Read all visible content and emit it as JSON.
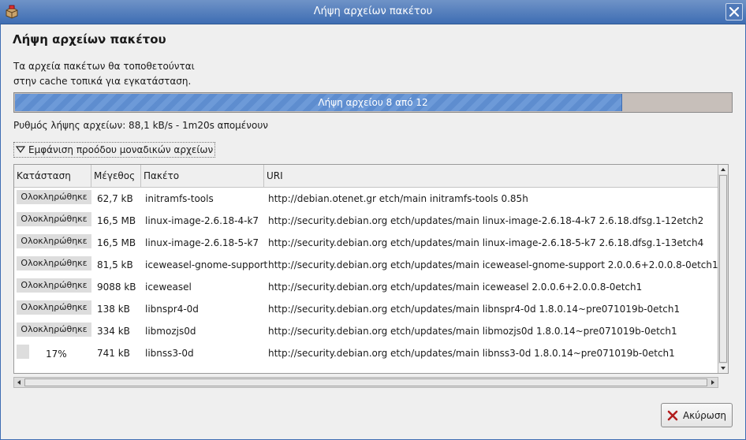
{
  "window": {
    "title": "Λήψη αρχείων πακέτου",
    "app_icon": "package-manager-icon",
    "close_icon": "close-icon"
  },
  "dialog": {
    "heading": "Λήψη αρχείων πακέτου",
    "description_line1": "Τα αρχεία πακέτων θα τοποθετούνται",
    "description_line2": "στην cache τοπικά για εγκατάσταση.",
    "progress": {
      "text": "Λήψη αρχείου 8 από 12",
      "fraction": 0.847
    },
    "rate_text": "Ρυθμός λήψης αρχείων: 88,1 kB/s - 1m20s απομένουν",
    "expander_label": "Εμφάνιση προόδου μοναδικών αρχείων",
    "cancel_label": "Ακύρωση",
    "cancel_icon": "cancel-x-icon"
  },
  "table": {
    "columns": [
      "Κατάσταση",
      "Μέγεθος",
      "Πακέτο",
      "URI"
    ],
    "rows": [
      {
        "status": "Ολοκληρώθηκε",
        "size": "62,7 kB",
        "package": "initramfs-tools",
        "uri": "http://debian.otenet.gr etch/main initramfs-tools 0.85h"
      },
      {
        "status": "Ολοκληρώθηκε",
        "size": "16,5 MB",
        "package": "linux-image-2.6.18-4-k7",
        "uri": "http://security.debian.org etch/updates/main linux-image-2.6.18-4-k7 2.6.18.dfsg.1-12etch2"
      },
      {
        "status": "Ολοκληρώθηκε",
        "size": "16,5 MB",
        "package": "linux-image-2.6.18-5-k7",
        "uri": "http://security.debian.org etch/updates/main linux-image-2.6.18-5-k7 2.6.18.dfsg.1-13etch4"
      },
      {
        "status": "Ολοκληρώθηκε",
        "size": "81,5 kB",
        "package": "iceweasel-gnome-support",
        "uri": "http://security.debian.org etch/updates/main iceweasel-gnome-support 2.0.0.6+2.0.0.8-0etch1"
      },
      {
        "status": "Ολοκληρώθηκε",
        "size": "9088 kB",
        "package": "iceweasel",
        "uri": "http://security.debian.org etch/updates/main iceweasel 2.0.0.6+2.0.0.8-0etch1"
      },
      {
        "status": "Ολοκληρώθηκε",
        "size": "138 kB",
        "package": "libnspr4-0d",
        "uri": "http://security.debian.org etch/updates/main libnspr4-0d 1.8.0.14~pre071019b-0etch1"
      },
      {
        "status": "Ολοκληρώθηκε",
        "size": "334 kB",
        "package": "libmozjs0d",
        "uri": "http://security.debian.org etch/updates/main libmozjs0d 1.8.0.14~pre071019b-0etch1"
      },
      {
        "status": "17%",
        "size": "741 kB",
        "package": "libnss3-0d",
        "uri": "http://security.debian.org etch/updates/main libnss3-0d 1.8.0.14~pre071019b-0etch1"
      }
    ]
  }
}
